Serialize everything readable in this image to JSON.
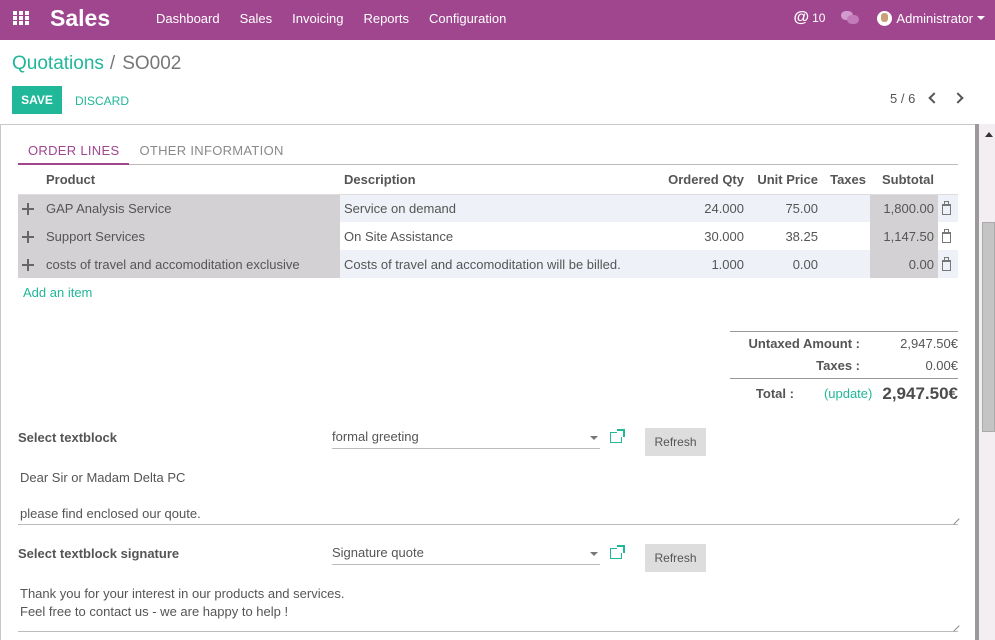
{
  "navbar": {
    "app_title": "Sales",
    "menu": [
      "Dashboard",
      "Sales",
      "Invoicing",
      "Reports",
      "Configuration"
    ],
    "mention_count": "10",
    "mention_symbol": "@",
    "user": "Administrator",
    "brand_color": "#a0468f"
  },
  "breadcrumb": {
    "parent": "Quotations",
    "separator": "/",
    "current": "SO002"
  },
  "actions": {
    "save": "SAVE",
    "discard": "DISCARD",
    "accent_color": "#21b799"
  },
  "pager": {
    "value": "5 / 6"
  },
  "tabs": [
    {
      "label": "ORDER LINES",
      "active": true
    },
    {
      "label": "OTHER INFORMATION",
      "active": false
    }
  ],
  "order_lines": {
    "columns": [
      "Product",
      "Description",
      "Ordered Qty",
      "Unit Price",
      "Taxes",
      "Subtotal"
    ],
    "rows": [
      {
        "product": "GAP Analysis Service",
        "description": "Service on demand",
        "qty": "24.000",
        "price": "75.00",
        "taxes": "",
        "subtotal": "1,800.00"
      },
      {
        "product": "Support Services",
        "description": "On Site Assistance",
        "qty": "30.000",
        "price": "38.25",
        "taxes": "",
        "subtotal": "1,147.50"
      },
      {
        "product": "costs of travel and accomoditation exclusive",
        "description": "Costs of travel and accomoditation will be billed.",
        "qty": "1.000",
        "price": "0.00",
        "taxes": "",
        "subtotal": "0.00"
      }
    ],
    "add_item": "Add an item"
  },
  "totals": {
    "untaxed_label": "Untaxed Amount :",
    "untaxed_value": "2,947.50€",
    "taxes_label": "Taxes :",
    "taxes_value": "0.00€",
    "total_label": "Total :",
    "update_label": "(update)",
    "total_value": "2,947.50€"
  },
  "textblock": {
    "label": "Select textblock",
    "selected": "formal greeting",
    "refresh": "Refresh",
    "lines": [
      "Dear Sir or Madam Delta PC",
      "",
      "please find enclosed our qoute."
    ]
  },
  "signature": {
    "label": "Select textblock signature",
    "selected": "Signature quote",
    "refresh": "Refresh",
    "lines": [
      "Thank you for your interest in our products and services.",
      "Feel free to contact us - we are happy to help !"
    ]
  }
}
